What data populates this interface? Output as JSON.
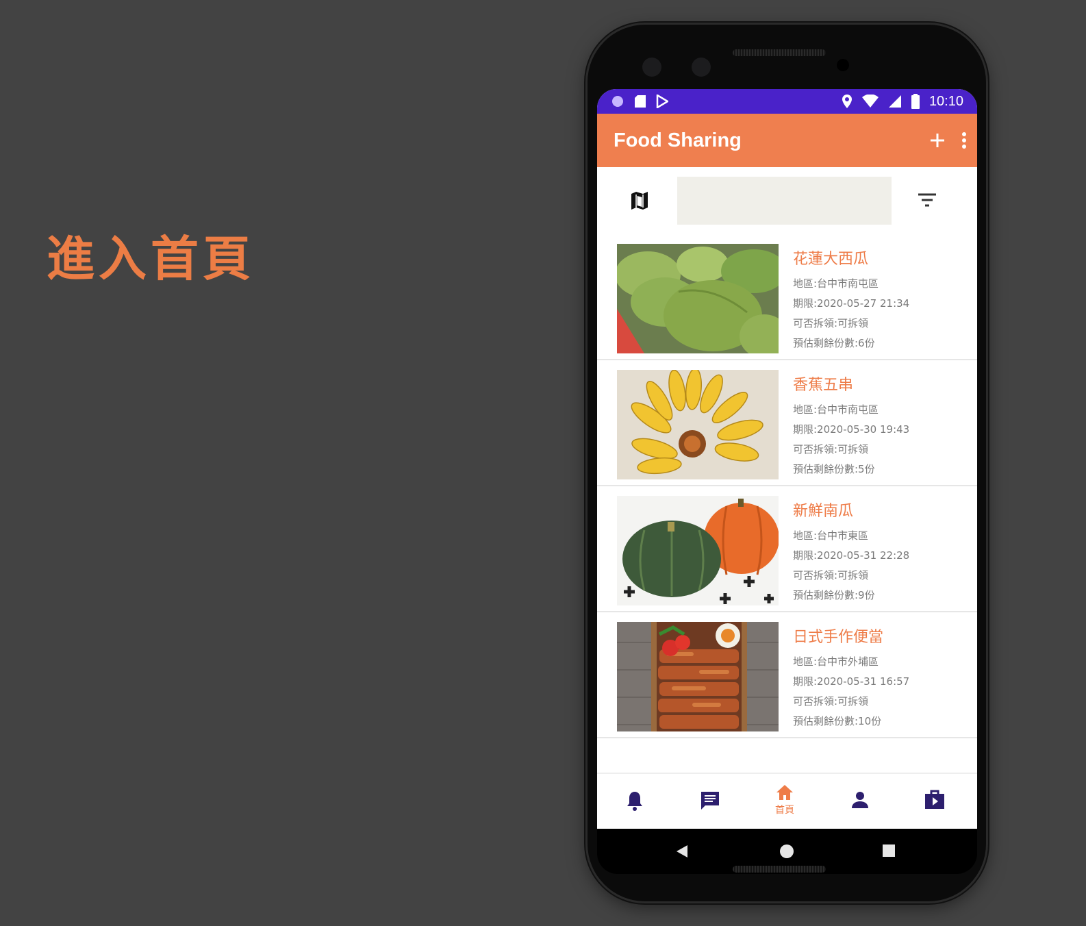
{
  "slide": {
    "title": "進入首頁"
  },
  "status_bar": {
    "time": "10:10"
  },
  "app_bar": {
    "title": "Food Sharing"
  },
  "search": {
    "placeholder": "",
    "value": ""
  },
  "items": [
    {
      "name": "花蓮大西瓜",
      "region": "地區:台中市南屯區",
      "deadline": "期限:2020-05-27 21:34",
      "split": "可否拆領:可拆領",
      "remaining": "預估剩餘份數:6份",
      "image": "watermelon"
    },
    {
      "name": "香蕉五串",
      "region": "地區:台中市南屯區",
      "deadline": "期限:2020-05-30 19:43",
      "split": "可否拆領:可拆領",
      "remaining": "預估剩餘份數:5份",
      "image": "banana"
    },
    {
      "name": "新鮮南瓜",
      "region": "地區:台中市東區",
      "deadline": "期限:2020-05-31 22:28",
      "split": "可否拆領:可拆領",
      "remaining": "預估剩餘份數:9份",
      "image": "pumpkin"
    },
    {
      "name": "日式手作便當",
      "region": "地區:台中市外埔區",
      "deadline": "期限:2020-05-31 16:57",
      "split": "可否拆領:可拆領",
      "remaining": "預估剩餘份數:10份",
      "image": "bento"
    }
  ],
  "bottom_nav": {
    "active_label": "首頁",
    "items": [
      "notifications-icon",
      "messages-icon",
      "home-icon",
      "profile-icon",
      "shop-icon"
    ]
  },
  "colors": {
    "accent": "#ef7f4f",
    "status_bar": "#4a22c9",
    "nav_icon": "#2d1f6e",
    "background": "#434343"
  }
}
